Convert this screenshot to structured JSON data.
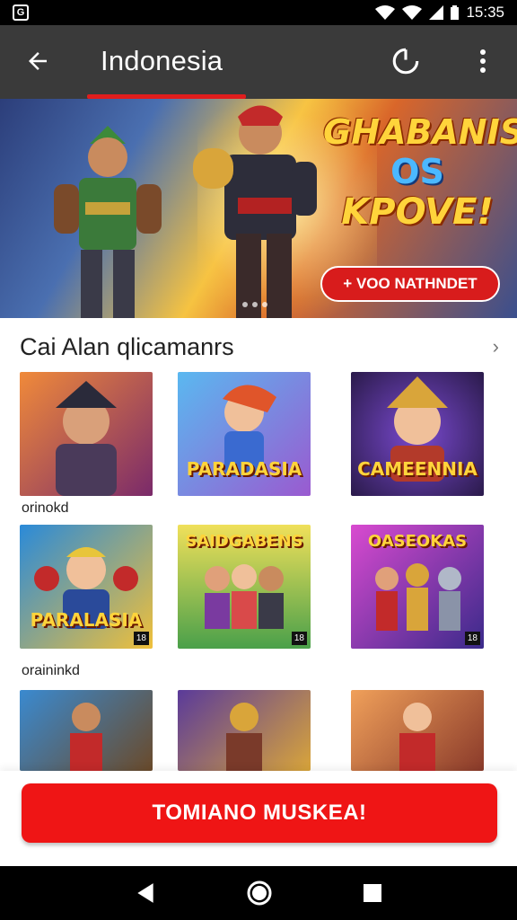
{
  "status_bar": {
    "time": "15:35",
    "icons": [
      "app-notification-icon",
      "wifi-icon",
      "signal-icon",
      "battery-icon"
    ]
  },
  "app_bar": {
    "title": "Indonesia",
    "back_icon": "arrow-left-icon",
    "refresh_icon": "refresh-icon",
    "more_icon": "more-vert-icon",
    "accent": "#e01d1d"
  },
  "banner": {
    "headline_1": "GHABANIS!",
    "headline_2": "OS",
    "headline_3": "KPOVE!",
    "cta_label": "+ VOO NATHNDET"
  },
  "section": {
    "title": "Cai Alan qlicamanrs",
    "chevron_icon": "chevron-right-icon"
  },
  "rows": [
    {
      "tiles": [
        {
          "name": "",
          "badge": ""
        },
        {
          "name": "PARADASIA",
          "badge": ""
        },
        {
          "name": "CAMEENNIA",
          "badge": ""
        }
      ],
      "caption": "orinokd"
    },
    {
      "tiles": [
        {
          "name": "PARALASIA",
          "badge": "18"
        },
        {
          "name": "SAIDGABENS",
          "badge": "18"
        },
        {
          "name": "OASEOKAS",
          "badge": "18"
        }
      ],
      "caption": "oraininkd"
    },
    {
      "tiles": [
        {
          "name": "",
          "badge": ""
        },
        {
          "name": "",
          "badge": ""
        },
        {
          "name": "",
          "badge": ""
        }
      ],
      "caption": ""
    }
  ],
  "main_cta": {
    "label": "TOMIANO MUSKEA!",
    "color": "#ef1515"
  },
  "nav_bar": {
    "icons": [
      "back-triangle-icon",
      "home-circle-icon",
      "recents-square-icon"
    ]
  }
}
